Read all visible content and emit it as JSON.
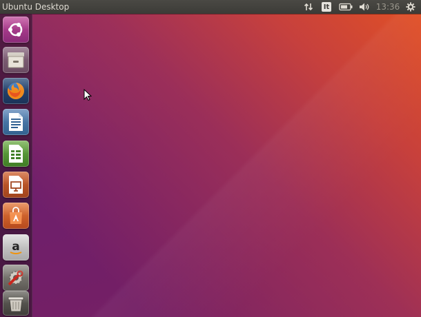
{
  "top_panel": {
    "title": "Ubuntu Desktop",
    "clock": "13:36",
    "keyboard_layout": "It"
  },
  "launcher": {
    "items": [
      {
        "name": "dash-home",
        "icon": "ubuntu-logo-icon"
      },
      {
        "name": "files",
        "icon": "file-cabinet-icon"
      },
      {
        "name": "firefox",
        "icon": "firefox-icon"
      },
      {
        "name": "libreoffice-writer",
        "icon": "document-icon"
      },
      {
        "name": "libreoffice-calc",
        "icon": "spreadsheet-icon"
      },
      {
        "name": "libreoffice-impress",
        "icon": "presentation-icon"
      },
      {
        "name": "ubuntu-software",
        "icon": "shopping-bag-icon"
      },
      {
        "name": "amazon",
        "icon": "amazon-icon"
      },
      {
        "name": "system-settings",
        "icon": "gear-wrench-icon"
      },
      {
        "name": "trash",
        "icon": "trash-icon"
      }
    ]
  },
  "colors": {
    "panel": "#3c3b37",
    "wallpaper_orange": "#e95420",
    "wallpaper_purple": "#6e1f6d"
  }
}
